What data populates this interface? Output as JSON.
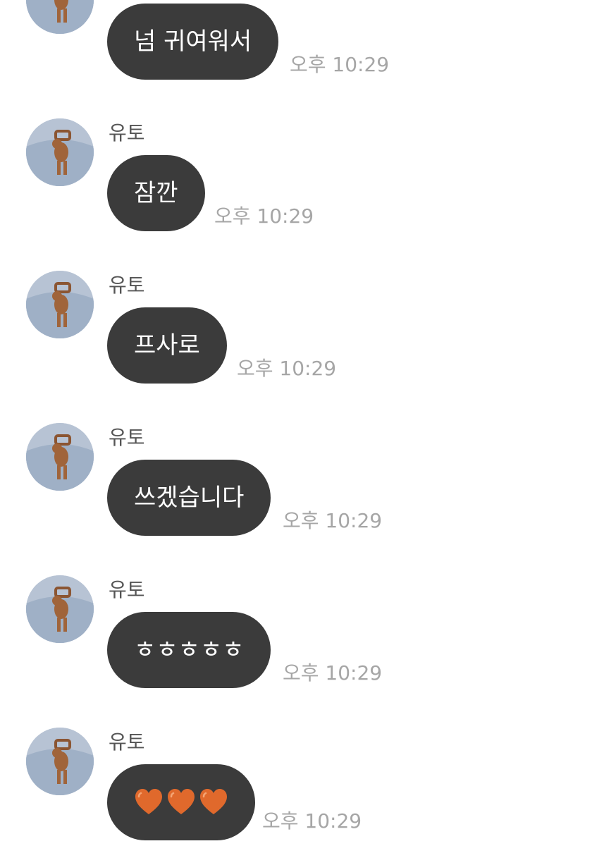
{
  "conversation": {
    "messages": [
      {
        "sender": "",
        "text": "넘 귀여워서",
        "time": "오후 10:29"
      },
      {
        "sender": "유토",
        "text": "잠깐",
        "time": "오후 10:29"
      },
      {
        "sender": "유토",
        "text": "프사로",
        "time": "오후 10:29"
      },
      {
        "sender": "유토",
        "text": "쓰겠습니다",
        "time": "오후 10:29"
      },
      {
        "sender": "유토",
        "text": "ㅎㅎㅎㅎㅎ",
        "time": "오후 10:29"
      },
      {
        "sender": "유토",
        "emoji": [
          "orange-heart-icon",
          "orange-heart-icon",
          "orange-heart-icon"
        ],
        "time": "오후 10:29"
      }
    ]
  },
  "colors": {
    "bubble": "#3b3b3b",
    "bubble_text": "#ffffff",
    "timestamp": "#a6a6a6",
    "sender": "#555555",
    "heart": "#e0692c"
  }
}
